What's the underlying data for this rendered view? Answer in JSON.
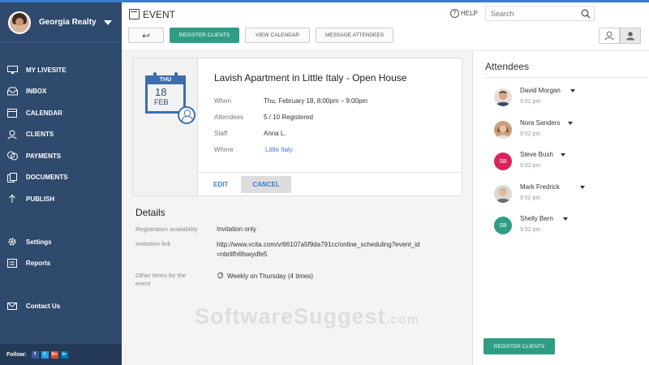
{
  "sidebar": {
    "account_name": "Georgia Realty",
    "items": [
      {
        "label": "MY LIVESITE",
        "icon": "monitor-icon"
      },
      {
        "label": "INBOX",
        "icon": "inbox-icon"
      },
      {
        "label": "CALENDAR",
        "icon": "calendar-icon"
      },
      {
        "label": "CLIENTS",
        "icon": "person-icon"
      },
      {
        "label": "PAYMENTS",
        "icon": "coins-icon"
      },
      {
        "label": "DOCUMENTS",
        "icon": "documents-icon"
      },
      {
        "label": "PUBLISH",
        "icon": "upload-icon"
      }
    ],
    "secondary": [
      {
        "label": "Settings",
        "icon": "gear-icon"
      },
      {
        "label": "Reports",
        "icon": "reports-icon"
      }
    ],
    "contact": {
      "label": "Contact Us",
      "icon": "envelope-icon"
    },
    "follow_label": "Follow:",
    "socials": [
      "f",
      "t",
      "G+",
      "in"
    ]
  },
  "header": {
    "title": "EVENT",
    "help_label": "HELP",
    "search_placeholder": "Search"
  },
  "toolbar": {
    "back_label": "↩",
    "register_label": "REGISTER CLIENTS",
    "calendar_label": "VIEW CALENDAR",
    "message_label": "MESSAGE ATTENDEES"
  },
  "event": {
    "cal_weekday": "THU",
    "cal_day": "18",
    "cal_month": "FEB",
    "name": "Lavish Apartment in Little Italy - Open House",
    "when_label": "When",
    "when_value": "Thu, February 18, 8:00pm – 9:00pm",
    "attendees_label": "Attendees",
    "attendees_value": "5 / 10 Registered",
    "staff_label": "Staff",
    "staff_value": "Anna L.",
    "where_label": "Where",
    "where_value": "Little Italy",
    "edit_label": "EDIT",
    "cancel_label": "CANCEL"
  },
  "details": {
    "title": "Details",
    "availability_label": "Registration availability",
    "availability_value": "Invitation only",
    "link_label": "Invitation link",
    "link_value": "http://www.vcita.com/v/66107a5f9da791cc/online_scheduling?event_id=nbrlifh6fswydfe5",
    "other_label": "Other times for the event",
    "other_value": "Weekly on Thursday (4 times)"
  },
  "watermark": {
    "main": "SoftwareSuggest",
    "suffix": ".com"
  },
  "attendees": {
    "title": "Attendees",
    "list": [
      {
        "name": "David Morgan",
        "time": "9:51 pm",
        "initials": "",
        "color": "#c8a48a"
      },
      {
        "name": "Nora Sanders",
        "time": "9:52 pm",
        "initials": "",
        "color": "#b57c5e"
      },
      {
        "name": "Steve Bush",
        "time": "9:52 pm",
        "initials": "SB",
        "color": "#d9245a"
      },
      {
        "name": "Mark Fredrick",
        "time": "9:52 pm",
        "initials": "",
        "color": "#a9a39d"
      },
      {
        "name": "Shelly Bern",
        "time": "9:52 pm",
        "initials": "SB",
        "color": "#2f9d84"
      }
    ],
    "register_label": "REGISTER CLIENTS"
  },
  "colors": {
    "sidebar": "#2f4a6d",
    "accent": "#2f9d84",
    "link": "#3a7bd5"
  }
}
